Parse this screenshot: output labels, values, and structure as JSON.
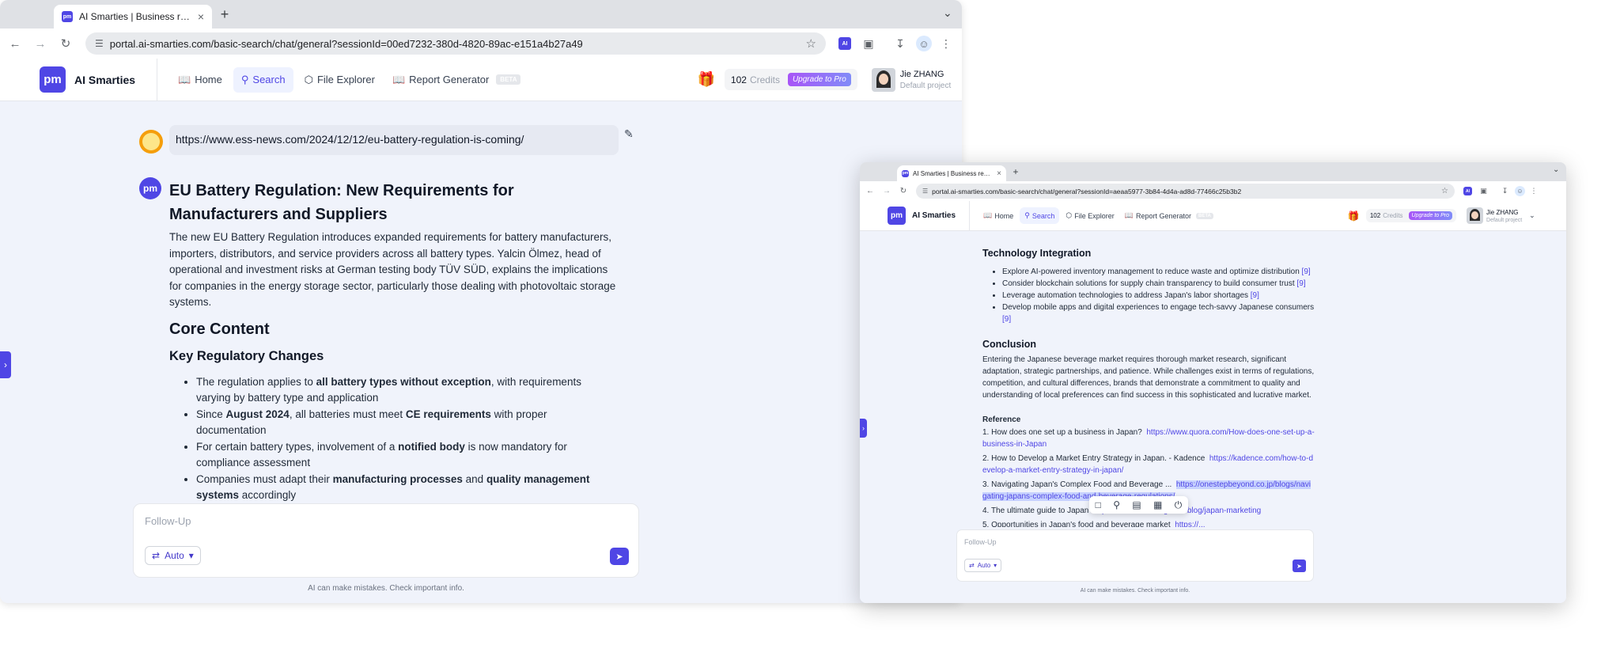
{
  "main_window": {
    "tab": {
      "favicon": "pm",
      "title": "AI Smarties | Business research",
      "close": "×"
    },
    "new_tab": "+",
    "tab_menu": "⌄",
    "url": "portal.ai-smarties.com/basic-search/chat/general?sessionId=00ed7232-380d-4820-89ac-e151a4b27a49",
    "ext_badge": "AI",
    "app": {
      "logo": "pm",
      "brand": "AI Smarties",
      "nav": [
        {
          "label": "Home",
          "icon": "book-icon"
        },
        {
          "label": "Search",
          "icon": "search-icon"
        },
        {
          "label": "File Explorer",
          "icon": "cube-icon"
        },
        {
          "label": "Report Generator",
          "icon": "book-icon"
        }
      ],
      "beta": "BETA",
      "credits_value": "102",
      "credits_label": "Credits",
      "upgrade": "Upgrade to Pro",
      "user_name": "Jie ZHANG",
      "user_project": "Default project"
    },
    "user_message": "https://www.ess-news.com/2024/12/12/eu-battery-regulation-is-coming/",
    "bot_avatar": "pm",
    "answer": {
      "title": "EU Battery Regulation: New Requirements for Manufacturers and Suppliers",
      "intro": "The new EU Battery Regulation introduces expanded requirements for battery manufacturers, importers, distributors, and service providers across all battery types. Yalcin Ölmez, head of operational and investment risks at German testing body TÜV SÜD, explains the implications for companies in the energy storage sector, particularly those dealing with photovoltaic storage systems.",
      "section": "Core Content",
      "subsection": "Key Regulatory Changes",
      "bullets": [
        {
          "a": "The regulation applies to ",
          "b": "all battery types without exception",
          "c": ", with requirements varying by battery type and application"
        },
        {
          "a": "Since ",
          "b": "August 2024",
          "c": ", all batteries must meet ",
          "d": "CE requirements",
          "e": " with proper documentation"
        },
        {
          "a": "For certain battery types, involvement of a ",
          "b": "notified body",
          "c": " is now mandatory for compliance assessment"
        },
        {
          "a": "Companies must adapt their ",
          "b": "manufacturing processes",
          "c": " and ",
          "d": "quality management systems",
          "e": " accordingly"
        }
      ]
    },
    "composer": {
      "placeholder": "Follow-Up",
      "mode": "Auto"
    },
    "disclaimer": "AI can make mistakes. Check important info."
  },
  "second_window": {
    "tab": {
      "favicon": "pm",
      "title": "AI Smarties | Business research",
      "close": "×"
    },
    "new_tab": "+",
    "url": "portal.ai-smarties.com/basic-search/chat/general?sessionId=aeaa5977-3b84-4d4a-ad8d-77466c25b3b2",
    "ext_badge": "AI",
    "app": {
      "logo": "pm",
      "brand": "AI Smarties",
      "nav": [
        "Home",
        "Search",
        "File Explorer",
        "Report Generator"
      ],
      "beta": "BETA",
      "credits_value": "102",
      "credits_label": "Credits",
      "upgrade": "Upgrade to Pro",
      "user_name": "Jie ZHANG",
      "user_project": "Default project"
    },
    "heading_tech": "Technology Integration",
    "tech_bullets": [
      {
        "text": "Explore AI-powered inventory management to reduce waste and optimize distribution ",
        "cite": "[9]"
      },
      {
        "text": "Consider blockchain solutions for supply chain transparency to build consumer trust ",
        "cite": "[9]"
      },
      {
        "text": "Leverage automation technologies to address Japan's labor shortages ",
        "cite": "[9]"
      },
      {
        "text": "Develop mobile apps and digital experiences to engage tech-savvy Japanese consumers ",
        "cite": "[9]"
      }
    ],
    "heading_conclusion": "Conclusion",
    "conclusion": "Entering the Japanese beverage market requires thorough market research, significant adaptation, strategic partnerships, and patience. While challenges exist in terms of regulations, competition, and cultural differences, brands that demonstrate a commitment to quality and understanding of local preferences can find success in this sophisticated and lucrative market.",
    "reference_heading": "Reference",
    "references": [
      {
        "n": "1.",
        "title": "How does one set up a business in Japan?",
        "url": "https://www.quora.com/How-does-one-set-up-a-business-in-Japan"
      },
      {
        "n": "2.",
        "title": "How to Develop a Market Entry Strategy in Japan. - Kadence",
        "url": "https://kadence.com/how-to-develop-a-market-entry-strategy-in-japan/"
      },
      {
        "n": "3.",
        "title": "Navigating Japan's Complex Food and Beverage ...",
        "url": "https://onestepbeyond.co.jp/blogs/navigating-japans-complex-food-and-beverage-regulations/"
      },
      {
        "n": "4.",
        "title": "The ultimate guide to Japan",
        "url": "https://www.smartling.com/blog/japan-marketing"
      },
      {
        "n": "5.",
        "title": "Opportunities in Japan's food and beverage market",
        "url": "https://..."
      }
    ],
    "composer": {
      "placeholder": "Follow-Up",
      "mode": "Auto"
    },
    "disclaimer": "AI can make mistakes. Check important info."
  },
  "colors": {
    "accent": "#4f46e5",
    "page_bg": "#f0f3fb",
    "chrome_tab_bg": "#dfe1e5"
  }
}
